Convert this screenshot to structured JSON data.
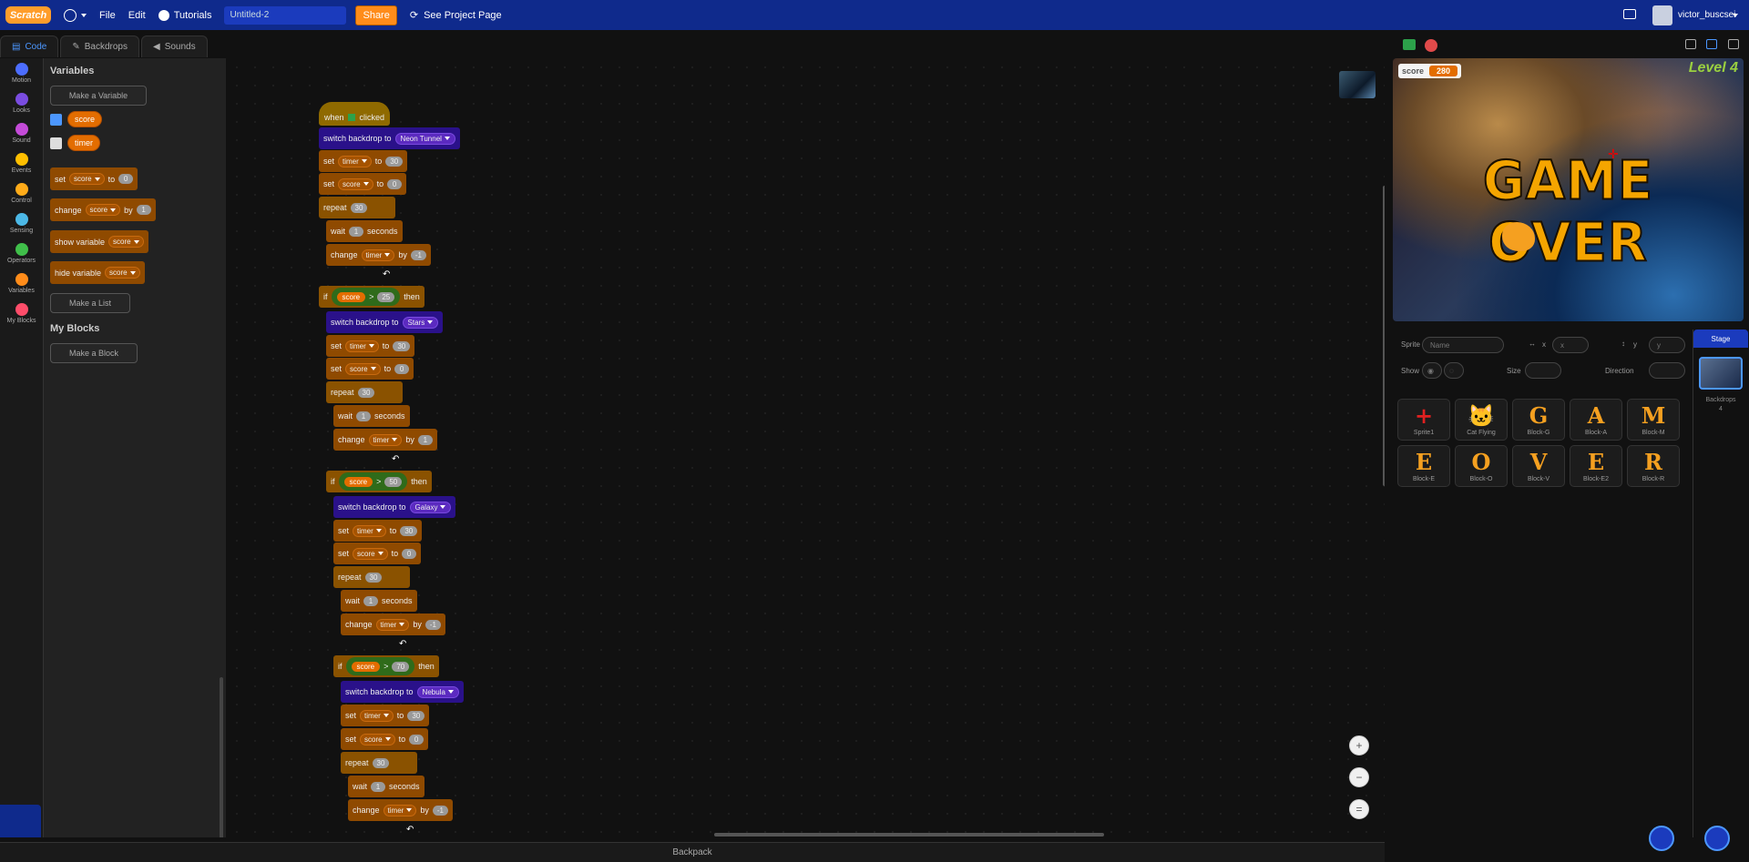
{
  "menubar": {
    "logo": "Scratch",
    "file": "File",
    "edit": "Edit",
    "tutorials": "Tutorials",
    "project_title": "Untitled-2",
    "share": "Share",
    "see_project": "See Project Page",
    "username": "victor_buscsei"
  },
  "tabs": {
    "code": "Code",
    "backdrops": "Backdrops",
    "sounds": "Sounds"
  },
  "categories": [
    {
      "label": "Motion",
      "color": "#4c6dff"
    },
    {
      "label": "Looks",
      "color": "#7a4ce0"
    },
    {
      "label": "Sound",
      "color": "#c44bd8"
    },
    {
      "label": "Events",
      "color": "#ffbf00"
    },
    {
      "label": "Control",
      "color": "#ffab19"
    },
    {
      "label": "Sensing",
      "color": "#4cb8e6"
    },
    {
      "label": "Operators",
      "color": "#40bf4a"
    },
    {
      "label": "Variables",
      "color": "#ff8c1a"
    },
    {
      "label": "My Blocks",
      "color": "#ff4d6a"
    }
  ],
  "palette": {
    "heading": "Variables",
    "make_variable": "Make a Variable",
    "var1": "score",
    "var2": "timer",
    "set_label": "set",
    "set_var": "score",
    "set_to": "to",
    "set_val": "0",
    "change_label": "change",
    "change_var": "score",
    "change_by": "by",
    "change_val": "1",
    "show_label": "show variable",
    "show_var": "score",
    "hide_label": "hide variable",
    "hide_var": "score",
    "make_list": "Make a List",
    "myblocks_heading": "My Blocks",
    "make_block": "Make a Block"
  },
  "script": {
    "when": "when",
    "clicked": "clicked",
    "switch": "switch backdrop to",
    "set": "set",
    "to": "to",
    "change": "change",
    "by": "by",
    "repeat": "repeat",
    "wait": "wait",
    "seconds": "seconds",
    "if": "if",
    "then": "then",
    "gt": ">",
    "timer": "timer",
    "score": "score",
    "b1": "Neon Tunnel",
    "b2": "Stars",
    "b3": "Galaxy",
    "b4": "Nebula",
    "t30": "30",
    "t0": "0",
    "t1": "1",
    "tm1": "-1",
    "c25": "25",
    "c50": "50",
    "c70": "70"
  },
  "stage": {
    "score_label": "score",
    "score_value": "280",
    "level": "Level 4",
    "game_over": "GAME OVER"
  },
  "sprite_info": {
    "sprite": "Sprite",
    "name_placeholder": "Name",
    "x": "x",
    "y": "y",
    "show": "Show",
    "size": "Size",
    "direction": "Direction"
  },
  "sprites": [
    {
      "glyph": "+",
      "name": "Sprite1"
    },
    {
      "glyph": "🐱",
      "name": "Cat Flying"
    },
    {
      "glyph": "G",
      "name": "Block-G"
    },
    {
      "glyph": "A",
      "name": "Block-A"
    },
    {
      "glyph": "M",
      "name": "Block-M"
    },
    {
      "glyph": "E",
      "name": "Block-E"
    },
    {
      "glyph": "O",
      "name": "Block-O"
    },
    {
      "glyph": "V",
      "name": "Block-V"
    },
    {
      "glyph": "E",
      "name": "Block-E2"
    },
    {
      "glyph": "R",
      "name": "Block-R"
    }
  ],
  "stage_pane": {
    "header": "Stage",
    "backdrops": "Backdrops",
    "count": "4"
  },
  "backpack": "Backpack"
}
